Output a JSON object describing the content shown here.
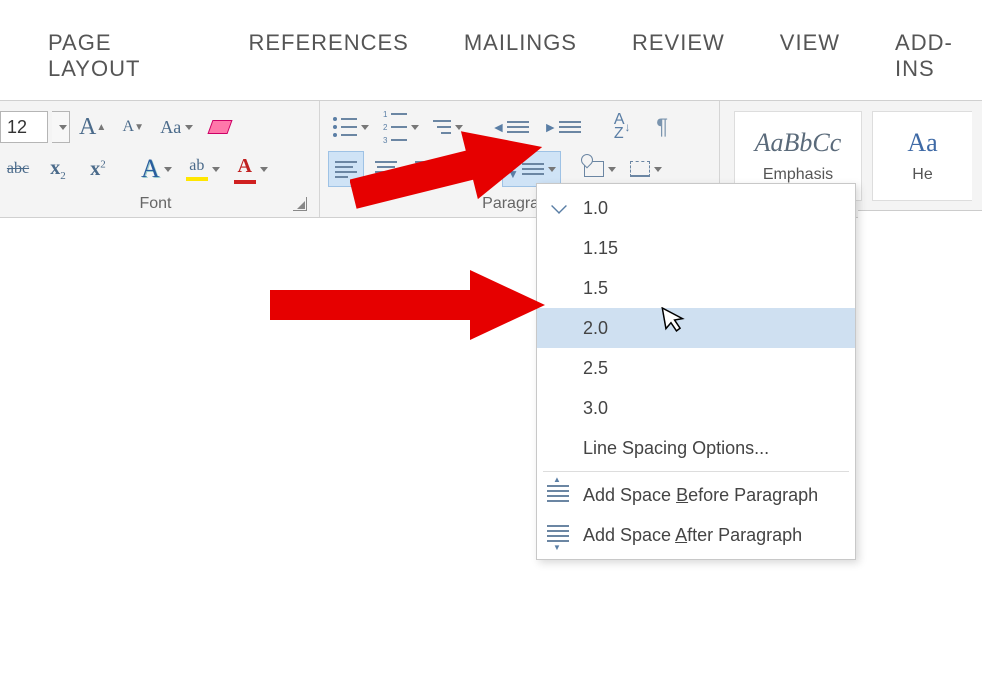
{
  "tabs": {
    "page_layout": "PAGE LAYOUT",
    "references": "REFERENCES",
    "mailings": "MAILINGS",
    "review": "REVIEW",
    "view": "VIEW",
    "addins": "ADD-INS"
  },
  "font": {
    "size": "12",
    "grow": "A",
    "shrink": "A",
    "case": "Aa",
    "strike": "abc",
    "sub_x": "x",
    "sub_2": "2",
    "sup_x": "x",
    "sup_2": "2",
    "effects": "A",
    "highlight": "ab",
    "color": "A",
    "group_label": "Font"
  },
  "paragraph": {
    "sort_label": "A\nZ",
    "pilcrow": "¶",
    "group_label": "Paragraph"
  },
  "styles": {
    "preview1": "AaBbCc",
    "name1": "Emphasis",
    "preview2": "Aa",
    "name2": "He"
  },
  "menu": {
    "v1": "1.0",
    "v2": "1.15",
    "v3": "1.5",
    "v4": "2.0",
    "v5": "2.5",
    "v6": "3.0",
    "opts": "Line Spacing Options...",
    "before_pre": "Add Space ",
    "before_u": "B",
    "before_post": "efore Paragraph",
    "after_pre": "Add Space ",
    "after_u": "A",
    "after_post": "fter Paragraph"
  }
}
